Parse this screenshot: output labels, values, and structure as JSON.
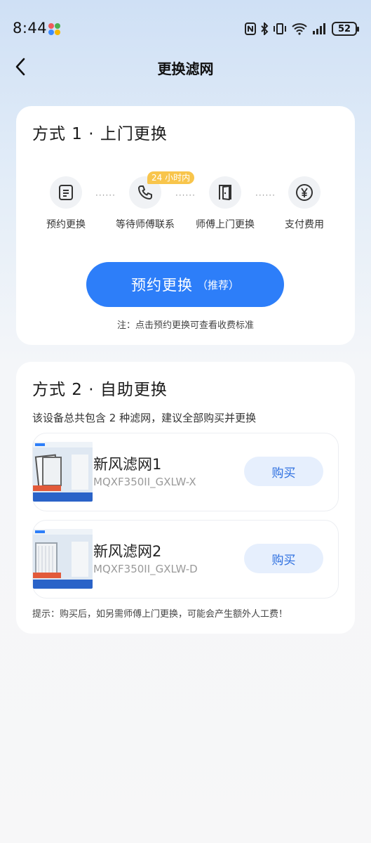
{
  "status_bar": {
    "time": "8:44",
    "battery": "52"
  },
  "nav": {
    "title": "更换滤网"
  },
  "method1": {
    "title": "方式 1 · 上门更换",
    "badge": "24 小时内",
    "steps": [
      {
        "label": "预约更换",
        "icon": "document-icon"
      },
      {
        "label": "等待师傅联系",
        "icon": "phone-icon"
      },
      {
        "label": "师傅上门更换",
        "icon": "door-icon"
      },
      {
        "label": "支付费用",
        "icon": "yen-icon"
      }
    ],
    "dots": "······",
    "button_main": "预约更换",
    "button_sub": "（推荐）",
    "note": "注：点击预约更换可查看收费标准"
  },
  "method2": {
    "title": "方式 2 · 自助更换",
    "desc": "该设备总共包含 2 种滤网，建议全部购买并更换",
    "products": [
      {
        "name": "新风滤网1",
        "model": "MQXF350II_GXLW-X",
        "buy": "购买"
      },
      {
        "name": "新风滤网2",
        "model": "MQXF350II_GXLW-D",
        "buy": "购买"
      }
    ],
    "tip": "提示：购买后，如另需师傅上门更换，可能会产生额外人工费！"
  },
  "colors": {
    "accent": "#2d7ef9",
    "badge": "#f8c54c",
    "buy_bg": "#e6effd"
  }
}
